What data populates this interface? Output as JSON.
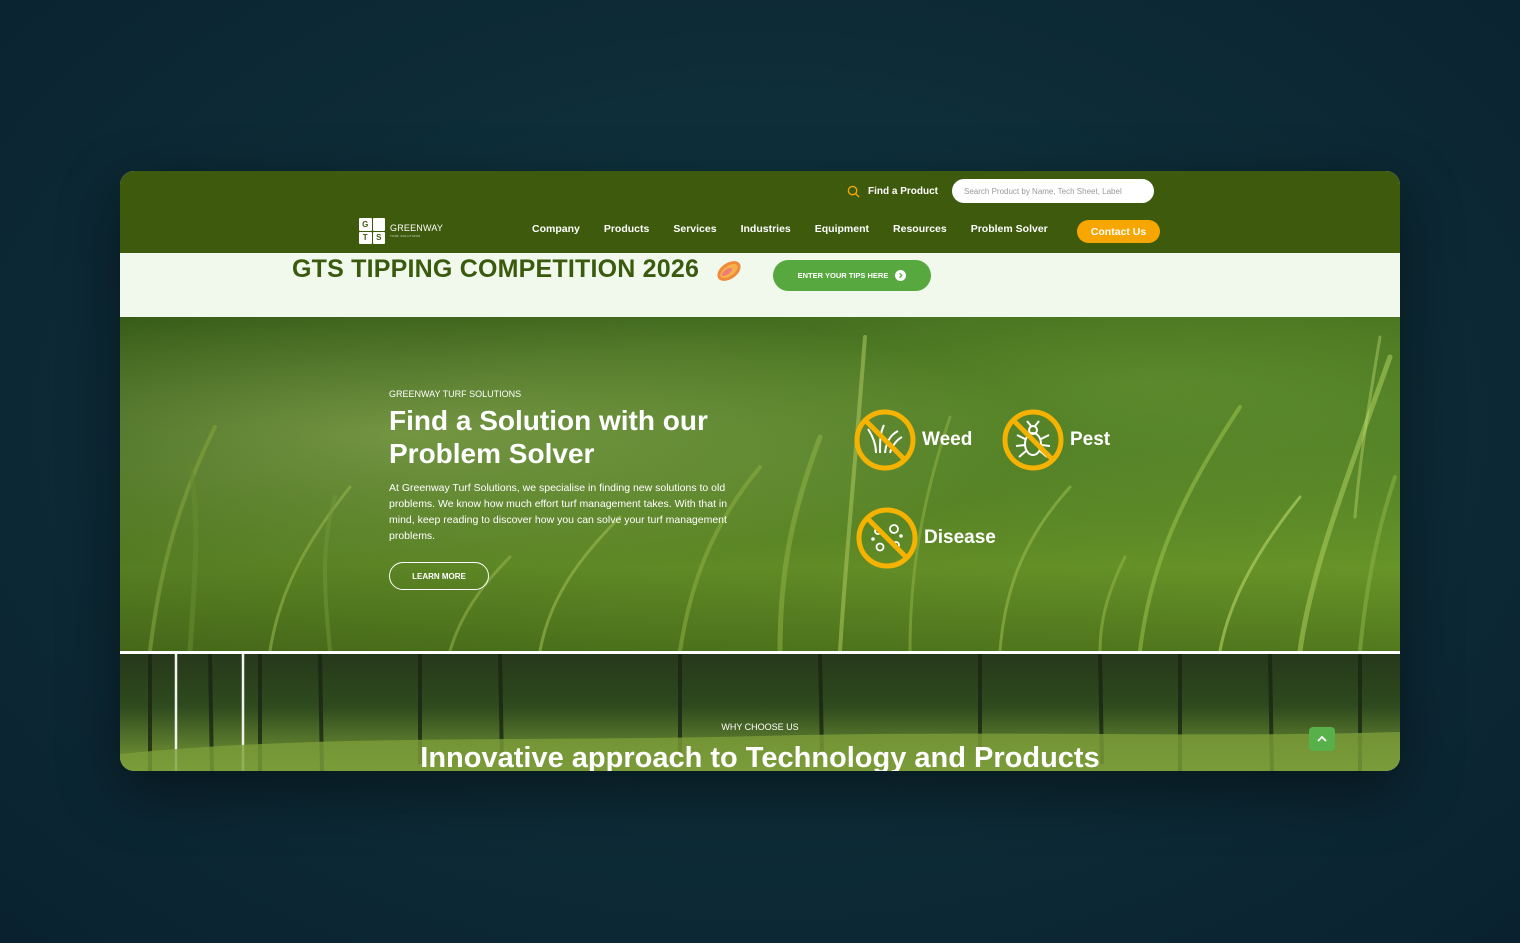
{
  "header": {
    "find_label": "Find a Product",
    "search_placeholder": "Search Product by Name, Tech Sheet, Label",
    "logo_letters": [
      "G",
      "",
      "T",
      "S"
    ],
    "logo_name": "GREENWAY",
    "logo_sub": "TURF SOLUTIONS",
    "nav": [
      "Company",
      "Products",
      "Services",
      "Industries",
      "Equipment",
      "Resources",
      "Problem Solver"
    ],
    "contact_label": "Contact Us"
  },
  "banner": {
    "title": "GTS TIPPING COMPETITION 2026",
    "tips_button": "ENTER YOUR TIPS HERE"
  },
  "hero": {
    "eyebrow": "GREENWAY TURF SOLUTIONS",
    "title": "Find a Solution with our Problem Solver",
    "text": "At Greenway Turf Solutions, we specialise in finding new solutions to old problems. We know how much effort turf management takes. With that in mind, keep reading to discover how you can solve your turf management problems.",
    "learn_more": "LEARN MORE",
    "solvers": {
      "weed": "Weed",
      "pest": "Pest",
      "disease": "Disease"
    }
  },
  "why": {
    "eyebrow": "WHY CHOOSE US",
    "title": "Innovative approach to Technology and Products"
  },
  "colors": {
    "header_green": "#3e5a0c",
    "accent_orange": "#f7a600",
    "button_green": "#57a83e",
    "banner_bg": "#f1f8ec",
    "icon_ring": "#f5b200"
  }
}
